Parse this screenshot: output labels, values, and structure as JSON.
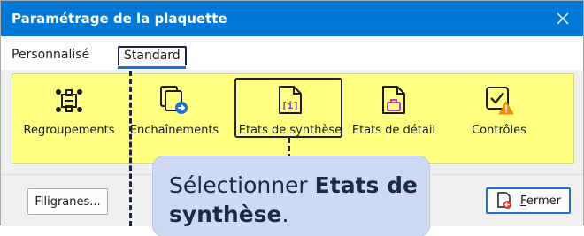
{
  "window": {
    "title": "Paramétrage de la plaquette"
  },
  "tabs": [
    {
      "label": "Personnalisé",
      "selected": false
    },
    {
      "label": "Standard",
      "selected": true
    }
  ],
  "ribbon": {
    "background": "#ffff80",
    "items": [
      {
        "label": "Regroupements",
        "icon": "group-icon"
      },
      {
        "label": "Enchaînements",
        "icon": "chain-docs-icon"
      },
      {
        "label": "Etats de synthèse",
        "icon": "info-document-icon",
        "highlighted": true
      },
      {
        "label": "Etats de détail",
        "icon": "detail-document-icon"
      },
      {
        "label": "Contrôles",
        "icon": "controls-warning-icon"
      }
    ]
  },
  "buttons": {
    "filigranes": "Filigranes...",
    "fermer_first": "F",
    "fermer_rest": "ermer"
  },
  "callout": {
    "prefix": "Sélectionner ",
    "bold": "Etats de synthèse",
    "suffix": "."
  },
  "colors": {
    "titlebar": "#0078d7",
    "accent": "#1e6fd9",
    "callout_bg": "#cfd9f4",
    "marker": "#1a2440"
  }
}
